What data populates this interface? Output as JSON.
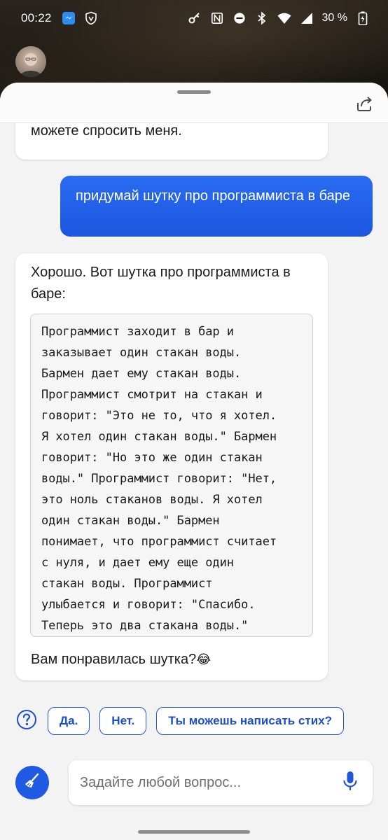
{
  "status_bar": {
    "time": "00:22",
    "battery_percent": "30 %"
  },
  "conversation": {
    "previous_bot_message_tail": "можете спросить меня.",
    "user_message": "придумай шутку про программиста в баре",
    "bot_intro": "Хорошо. Вот шутка про программиста в баре:",
    "bot_code": "Программист заходит в бар и\nзаказывает один стакан воды.\nБармен дает ему стакан воды.\nПрограммист смотрит на стакан и\nговорит: \"Это не то, что я хотел.\nЯ хотел один стакан воды.\" Бармен\nговорит: \"Но это же один стакан\nводы.\" Программист говорит: \"Нет,\nэто ноль стаканов воды. Я хотел\nодин стакан воды.\" Бармен\nпонимает, что программист считает\nс нуля, и дает ему еще один\nстакан воды. Программист\nулыбается и говорит: \"Спасибо.\nТеперь это два стакана воды.\"",
    "bot_question": "Вам понравилась шутка?",
    "bot_question_emoji": "😂"
  },
  "suggestions": [
    "Да.",
    "Нет.",
    "Ты можешь написать стих?"
  ],
  "composer": {
    "placeholder": "Задайте любой вопрос..."
  },
  "colors": {
    "accent": "#1f5ae3",
    "user_bubble": "#2a6cf2",
    "sheet_background": "#f3f3f3"
  },
  "icons": {
    "status_left": [
      "messenger-icon",
      "shield-icon"
    ],
    "status_right": [
      "key-icon",
      "nfc-icon",
      "do-not-disturb-icon",
      "bluetooth-icon",
      "wifi-icon",
      "signal-icon",
      "battery-icon"
    ],
    "share": "share-icon",
    "help": "help-icon",
    "new_topic": "broom-icon",
    "mic": "mic-icon"
  }
}
